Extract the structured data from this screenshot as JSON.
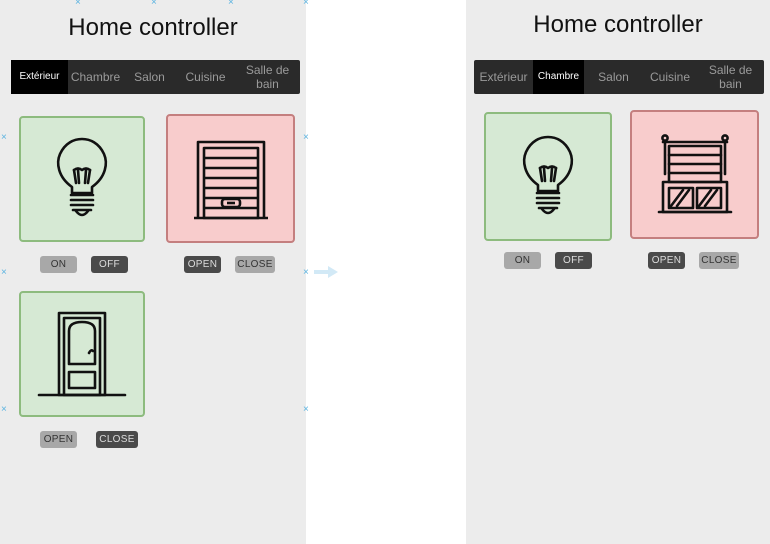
{
  "left_screen": {
    "title": "Home controller",
    "tabs": [
      {
        "label": "Extérieur",
        "active": true
      },
      {
        "label": "Chambre",
        "active": false
      },
      {
        "label": "Salon",
        "active": false
      },
      {
        "label": "Cuisine",
        "active": false
      },
      {
        "label": "Salle de bain",
        "active": false
      }
    ],
    "devices": [
      {
        "name": "bulb",
        "icon": "lightbulb-icon",
        "state": "green",
        "buttons": [
          "ON",
          "OFF"
        ]
      },
      {
        "name": "garage",
        "icon": "garage-door-icon",
        "state": "red",
        "buttons": [
          "OPEN",
          "CLOSE"
        ]
      },
      {
        "name": "door",
        "icon": "door-icon",
        "state": "green",
        "buttons": [
          "OPEN",
          "CLOSE"
        ]
      }
    ]
  },
  "right_screen": {
    "title": "Home controller",
    "tabs": [
      {
        "label": "Extérieur",
        "active": false
      },
      {
        "label": "Chambre",
        "active": true
      },
      {
        "label": "Salon",
        "active": false
      },
      {
        "label": "Cuisine",
        "active": false
      },
      {
        "label": "Salle de bain",
        "active": false
      }
    ],
    "devices": [
      {
        "name": "bulb",
        "icon": "lightbulb-icon",
        "state": "green",
        "buttons": [
          "ON",
          "OFF"
        ]
      },
      {
        "name": "blinds",
        "icon": "window-blinds-icon",
        "state": "red",
        "buttons": [
          "OPEN",
          "CLOSE"
        ]
      }
    ]
  },
  "colors": {
    "tile_green_bg": "#d6e9d4",
    "tile_red_bg": "#f8cccc",
    "tab_bar": "#2a2a2a",
    "tab_active": "#000000"
  }
}
